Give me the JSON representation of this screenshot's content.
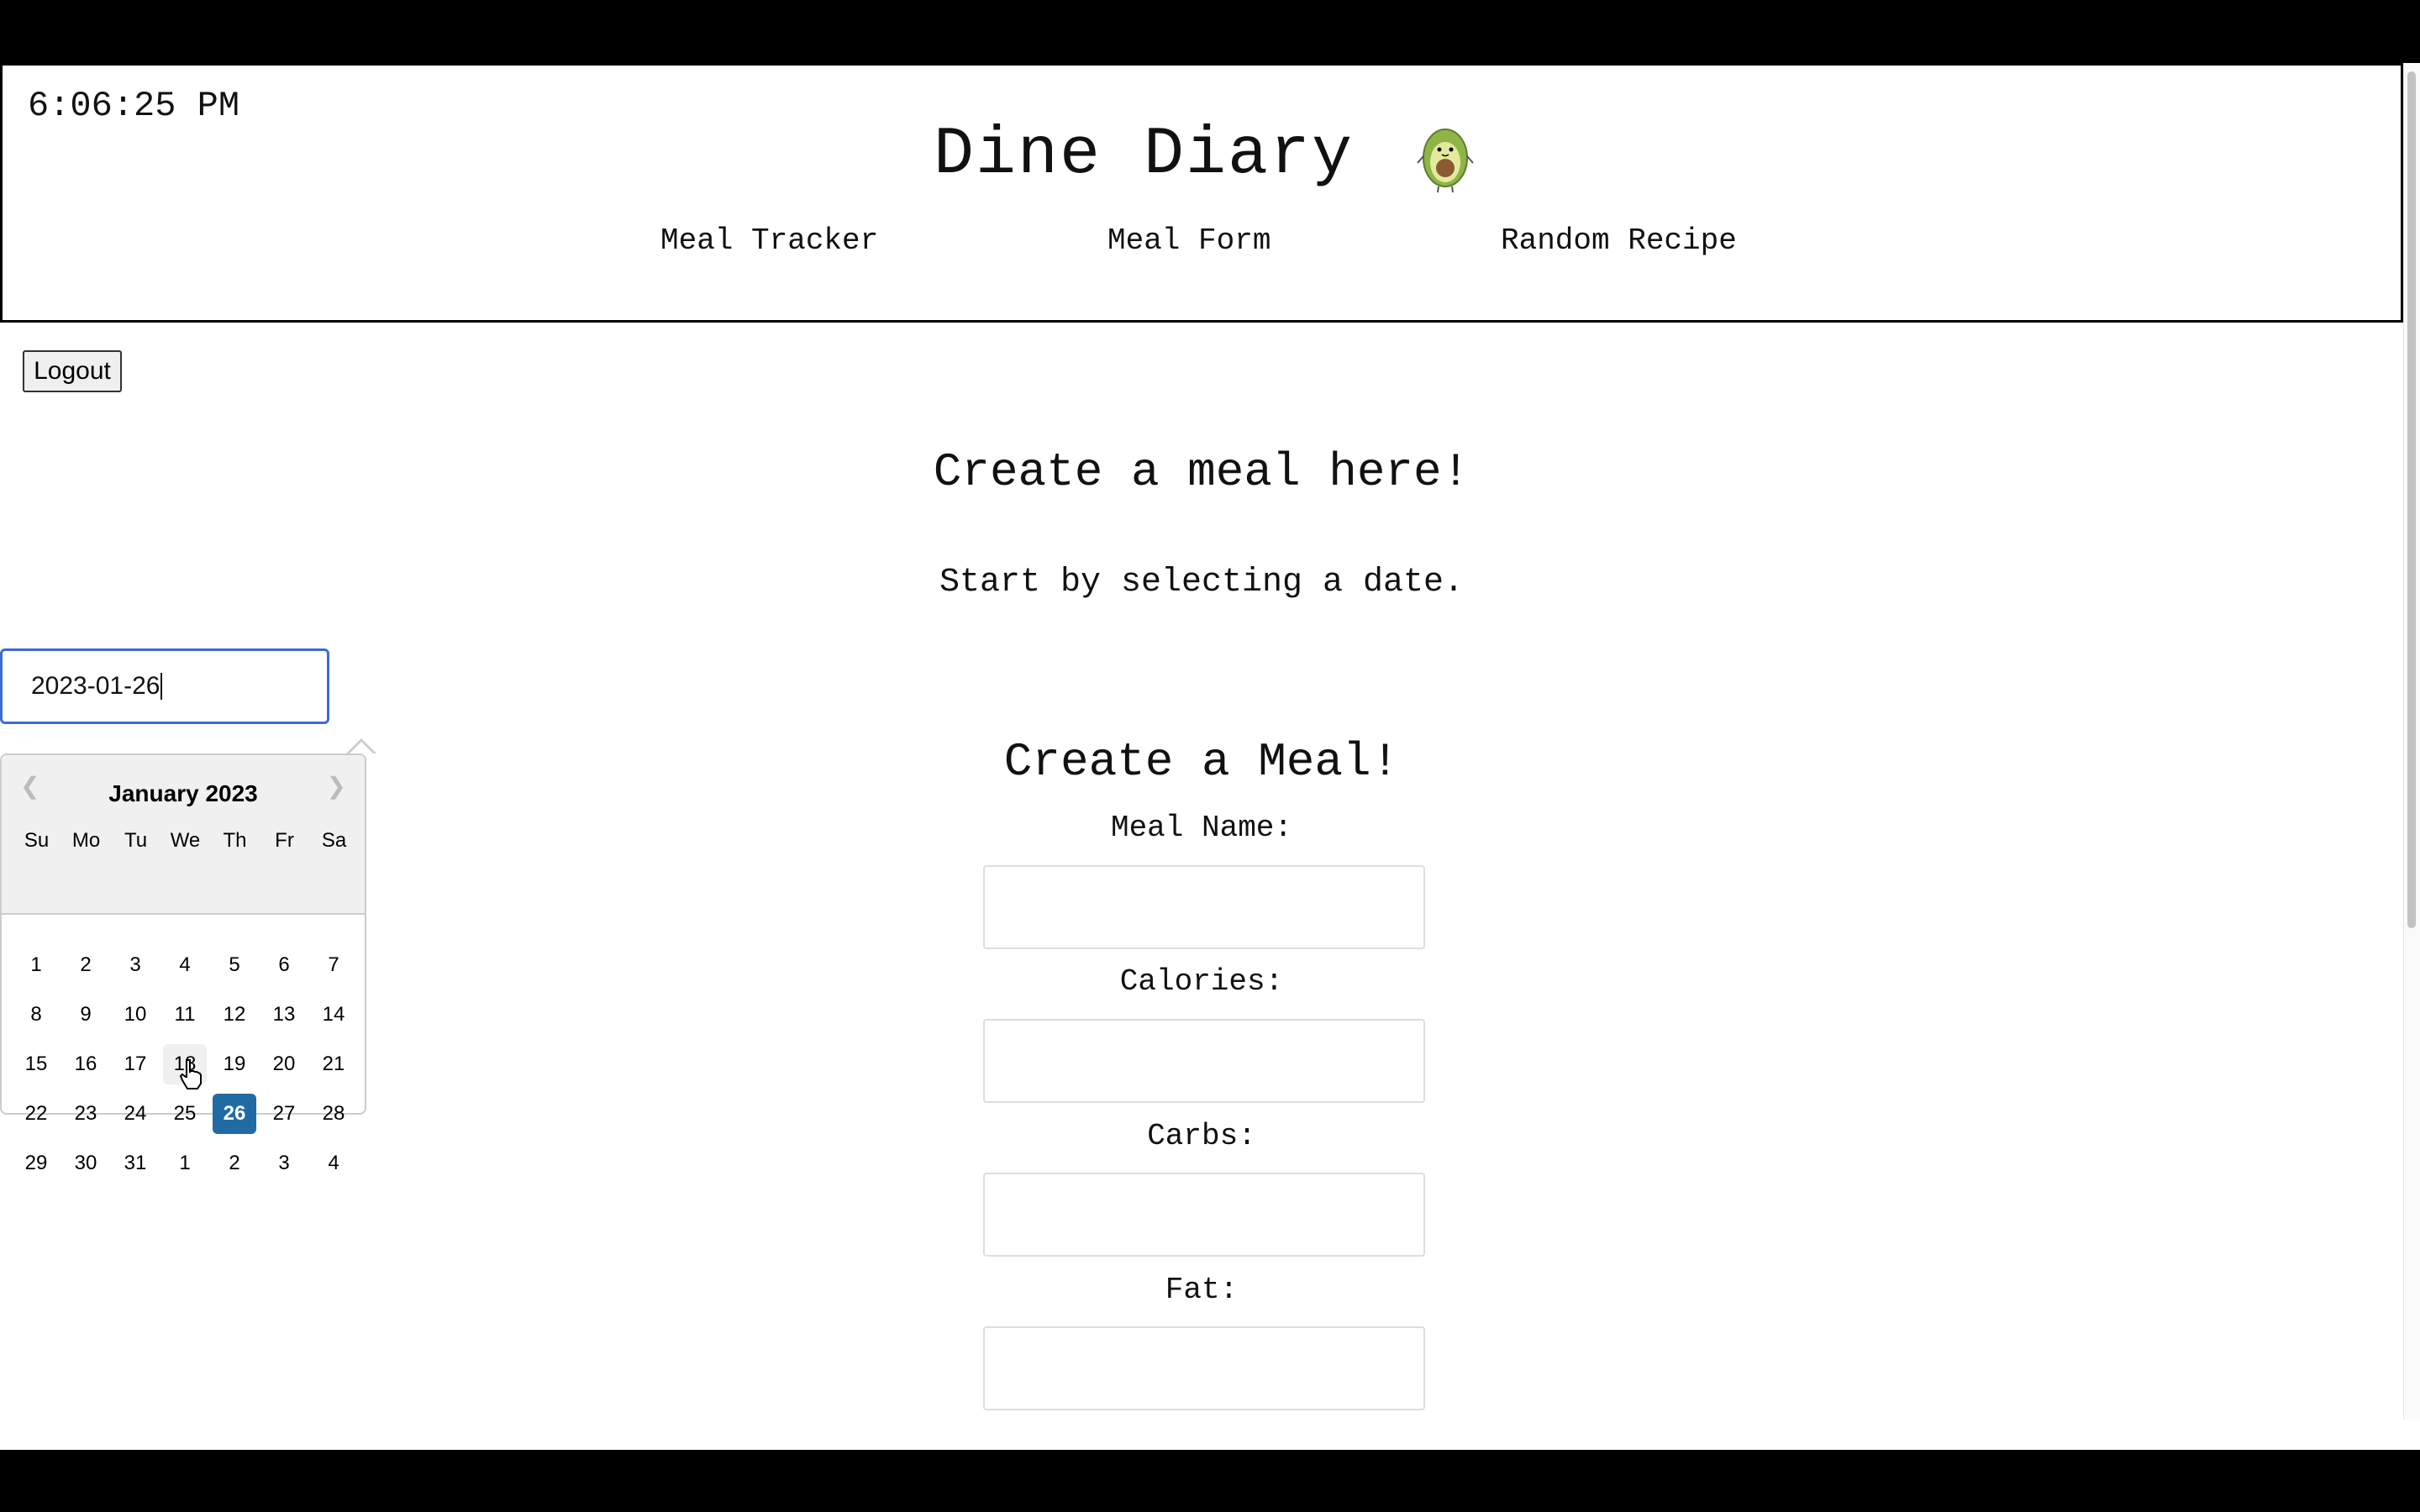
{
  "header": {
    "clock": "6:06:25 PM",
    "title": "Dine Diary",
    "nav": [
      "Meal Tracker",
      "Meal Form",
      "Random Recipe"
    ]
  },
  "logout_label": "Logout",
  "page": {
    "heading": "Create a meal here!",
    "subheading": "Start by selecting a date."
  },
  "date_input": {
    "value": "2023-01-26"
  },
  "datepicker": {
    "month_label": "January 2023",
    "weekdays": [
      "Su",
      "Mo",
      "Tu",
      "We",
      "Th",
      "Fr",
      "Sa"
    ],
    "weeks": [
      [
        "1",
        "2",
        "3",
        "4",
        "5",
        "6",
        "7"
      ],
      [
        "8",
        "9",
        "10",
        "11",
        "12",
        "13",
        "14"
      ],
      [
        "15",
        "16",
        "17",
        "18",
        "19",
        "20",
        "21"
      ],
      [
        "22",
        "23",
        "24",
        "25",
        "26",
        "27",
        "28"
      ],
      [
        "29",
        "30",
        "31",
        "1",
        "2",
        "3",
        "4"
      ]
    ],
    "selected_day": "26",
    "hovered_day": "18"
  },
  "form": {
    "title": "Create a Meal!",
    "fields": [
      "Meal Name:",
      "Calories:",
      "Carbs:",
      "Fat:"
    ]
  },
  "colors": {
    "accent": "#216ba5",
    "focus_border": "#3b6cd4"
  }
}
